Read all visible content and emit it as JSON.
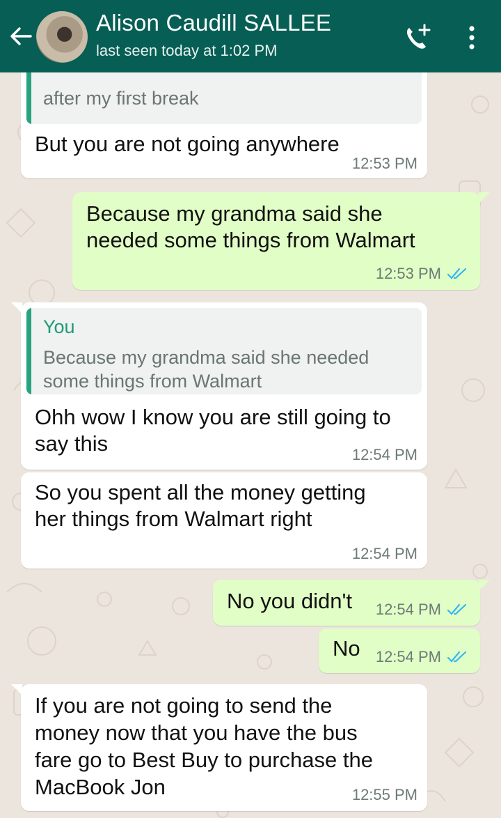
{
  "header": {
    "contact_name": "Alison Caudill SALLEE",
    "status": "last seen today at 1:02 PM",
    "icons": [
      "back-arrow-icon",
      "avatar",
      "add-call-icon",
      "more-vert-icon"
    ]
  },
  "colors": {
    "header": "#075e54",
    "outgoing_bubble": "#e1fec6",
    "incoming_bubble": "#ffffff",
    "quote_accent": "#26a37f",
    "read_ticks": "#34b7f1"
  },
  "messages": [
    {
      "direction": "incoming",
      "quote_text": "Because I thought I was going to Walmart after my first break",
      "quote_visible_line": "after my first break",
      "text": "But you are not going anywhere",
      "time": "12:53 PM"
    },
    {
      "direction": "outgoing",
      "text_line1": "Because my grandma said she",
      "text_line2": "needed some things from Walmart",
      "time": "12:53 PM",
      "status": "read"
    },
    {
      "direction": "incoming",
      "quote_author": "You",
      "quote_line1": "Because my grandma said she needed",
      "quote_line2": "some things from Walmart",
      "text_line1": "Ohh wow I know you are still going to",
      "text_line2": "say this",
      "time": "12:54 PM"
    },
    {
      "direction": "incoming",
      "text_line1": "So you spent all the money getting",
      "text_line2": "her things from Walmart right",
      "time": "12:54 PM"
    },
    {
      "direction": "outgoing",
      "text": "No you didn't",
      "time": "12:54 PM",
      "status": "read"
    },
    {
      "direction": "outgoing",
      "text": "No",
      "time": "12:54 PM",
      "status": "read"
    },
    {
      "direction": "incoming",
      "text_line1": "If you are not going to send the",
      "text_line2": "money now that you have the bus",
      "text_line3": "fare go to Best Buy to purchase the",
      "text_line4": "MacBook Jon",
      "time": "12:55 PM"
    }
  ]
}
